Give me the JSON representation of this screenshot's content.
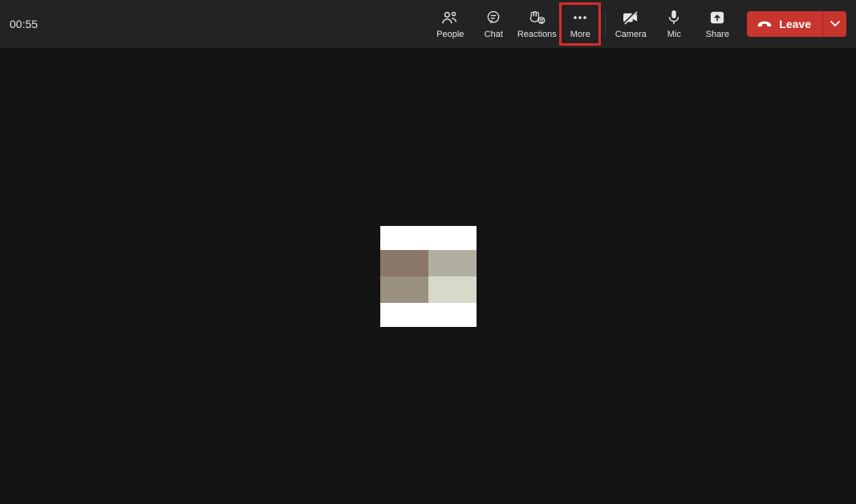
{
  "timer": "00:55",
  "toolbar": {
    "people": "People",
    "chat": "Chat",
    "reactions": "Reactions",
    "more": "More",
    "camera": "Camera",
    "mic": "Mic",
    "share": "Share"
  },
  "leave": {
    "label": "Leave"
  },
  "highlight": {
    "target": "more-button"
  }
}
